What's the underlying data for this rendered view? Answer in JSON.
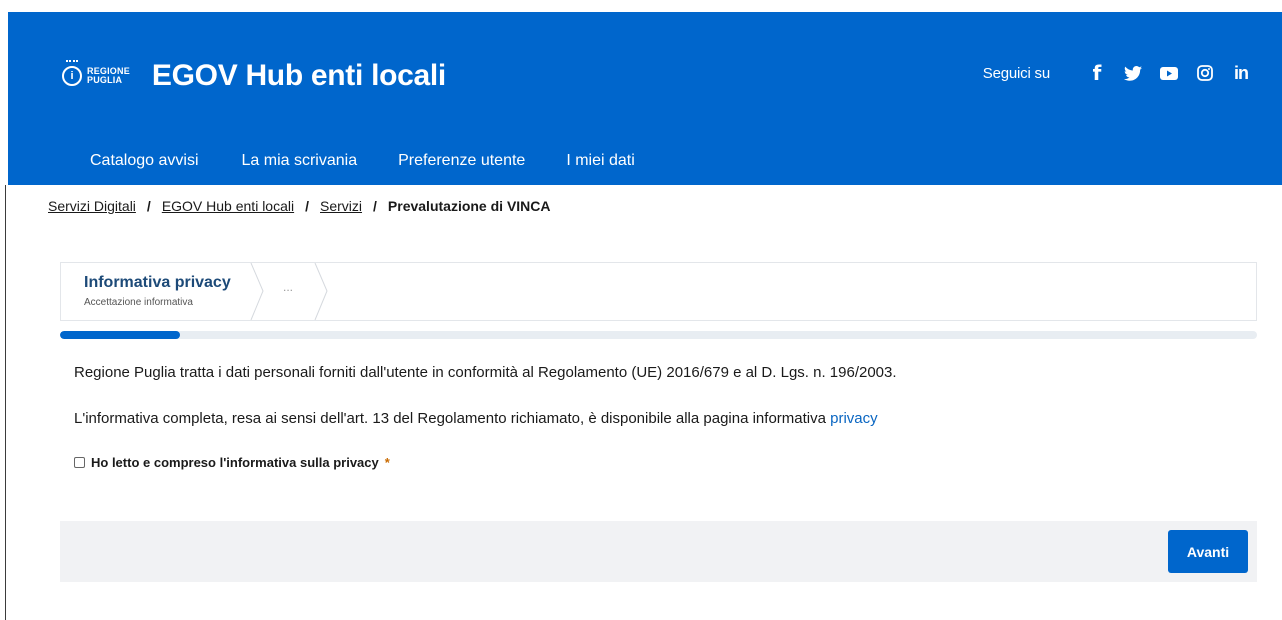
{
  "header": {
    "logo_line1": "REGIONE",
    "logo_line2": "PUGLIA",
    "title": "EGOV Hub enti locali",
    "social_label": "Seguici su",
    "social_icons": [
      "facebook-icon",
      "twitter-icon",
      "youtube-icon",
      "instagram-icon",
      "linkedin-icon"
    ]
  },
  "nav": {
    "items": [
      {
        "label": "Catalogo avvisi"
      },
      {
        "label": "La mia scrivania"
      },
      {
        "label": "Preferenze utente"
      },
      {
        "label": "I miei dati"
      }
    ]
  },
  "breadcrumb": {
    "items": [
      "Servizi Digitali",
      "EGOV Hub enti locali",
      "Servizi"
    ],
    "separator": "/",
    "current": "Prevalutazione di VINCA"
  },
  "steps": {
    "active_title": "Informativa privacy",
    "active_subtitle": "Accettazione informativa",
    "next_placeholder": "..."
  },
  "progress": {
    "fraction": 0.1
  },
  "content": {
    "paragraph1": "Regione Puglia tratta i dati personali forniti dall'utente in conformità al Regolamento (UE) 2016/679 e al D. Lgs. n. 196/2003.",
    "paragraph2_text": "L'informativa completa, resa ai sensi dell'art. 13 del Regolamento richiamato, è disponibile alla pagina informativa ",
    "paragraph2_link": "privacy",
    "checkbox_label": "Ho letto e compreso l'informativa sulla privacy",
    "checkbox_checked": false,
    "required_marker": "*"
  },
  "actions": {
    "next_label": "Avanti"
  },
  "colors": {
    "primary": "#0066cc",
    "step_title": "#1d4a78",
    "link": "#0a66c2",
    "required": "#c96a00",
    "footer_bg": "#f1f2f4"
  }
}
